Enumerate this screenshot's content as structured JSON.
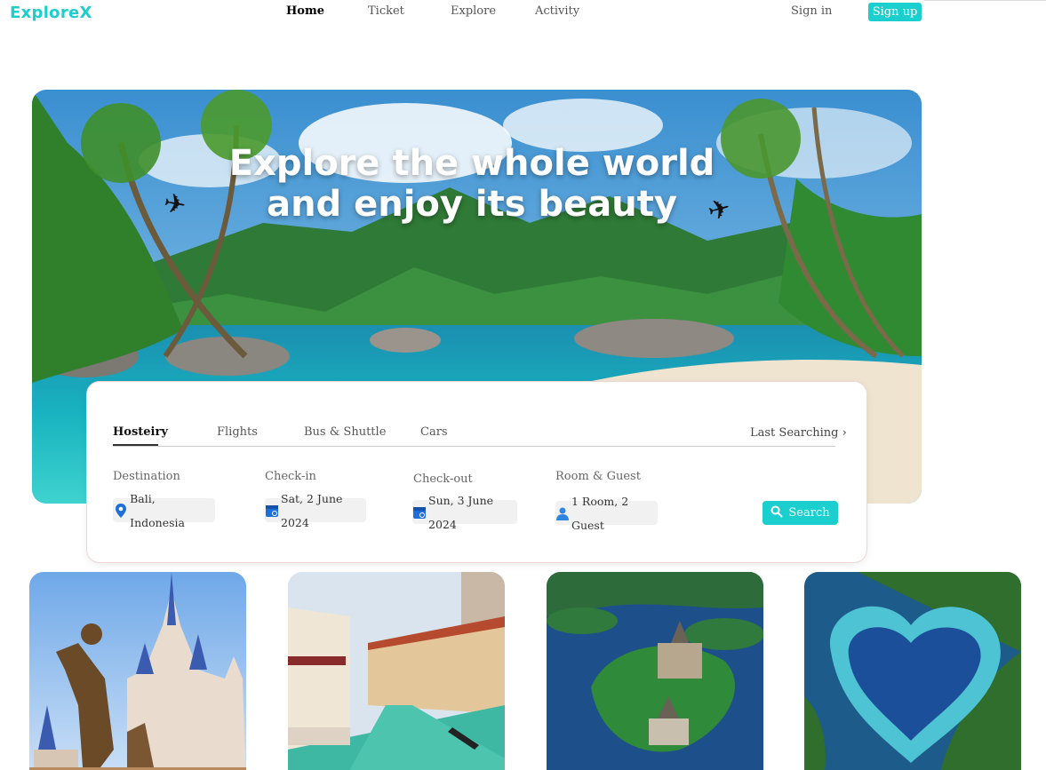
{
  "brand": {
    "logo": "ExploreX",
    "accent_color": "#1ccfcf"
  },
  "nav": {
    "links": [
      {
        "label": "Home",
        "active": true
      },
      {
        "label": "Ticket",
        "active": false
      },
      {
        "label": "Explore",
        "active": false
      },
      {
        "label": "Activity",
        "active": false
      }
    ],
    "sign_in": "Sign in",
    "sign_up": "Sign up"
  },
  "hero": {
    "title_line1": "Explore the whole world",
    "title_line2": "and enjoy its beauty",
    "plane_icon": "✈"
  },
  "search": {
    "tabs": [
      {
        "label": "Hosteiry",
        "active": true
      },
      {
        "label": "Flights",
        "active": false
      },
      {
        "label": "Bus & Shuttle",
        "active": false
      },
      {
        "label": "Cars",
        "active": false
      }
    ],
    "last_searching": "Last Searching",
    "chevron": "›",
    "fields": {
      "destination": {
        "label": "Destination",
        "value": "Bali, Indonesia",
        "icon": "location-pin-icon"
      },
      "checkin": {
        "label": "Check-in",
        "value": "Sat, 2 June 2024",
        "icon": "calendar-icon"
      },
      "checkout": {
        "label": "Check-out",
        "value": "Sun, 3 June 2024",
        "icon": "calendar-icon"
      },
      "room_guest": {
        "label": "Room & Guest",
        "value": "1 Room, 2 Guest",
        "icon": "person-icon"
      }
    },
    "button_label": "Search",
    "button_icon": "magnifier-icon"
  },
  "destinations": [
    {
      "name": "castle-statue",
      "icon": "castle-photo"
    },
    {
      "name": "venice-canal",
      "icon": "canal-photo"
    },
    {
      "name": "island-castle",
      "icon": "island-photo"
    },
    {
      "name": "heart-lagoon",
      "icon": "lagoon-photo"
    }
  ]
}
